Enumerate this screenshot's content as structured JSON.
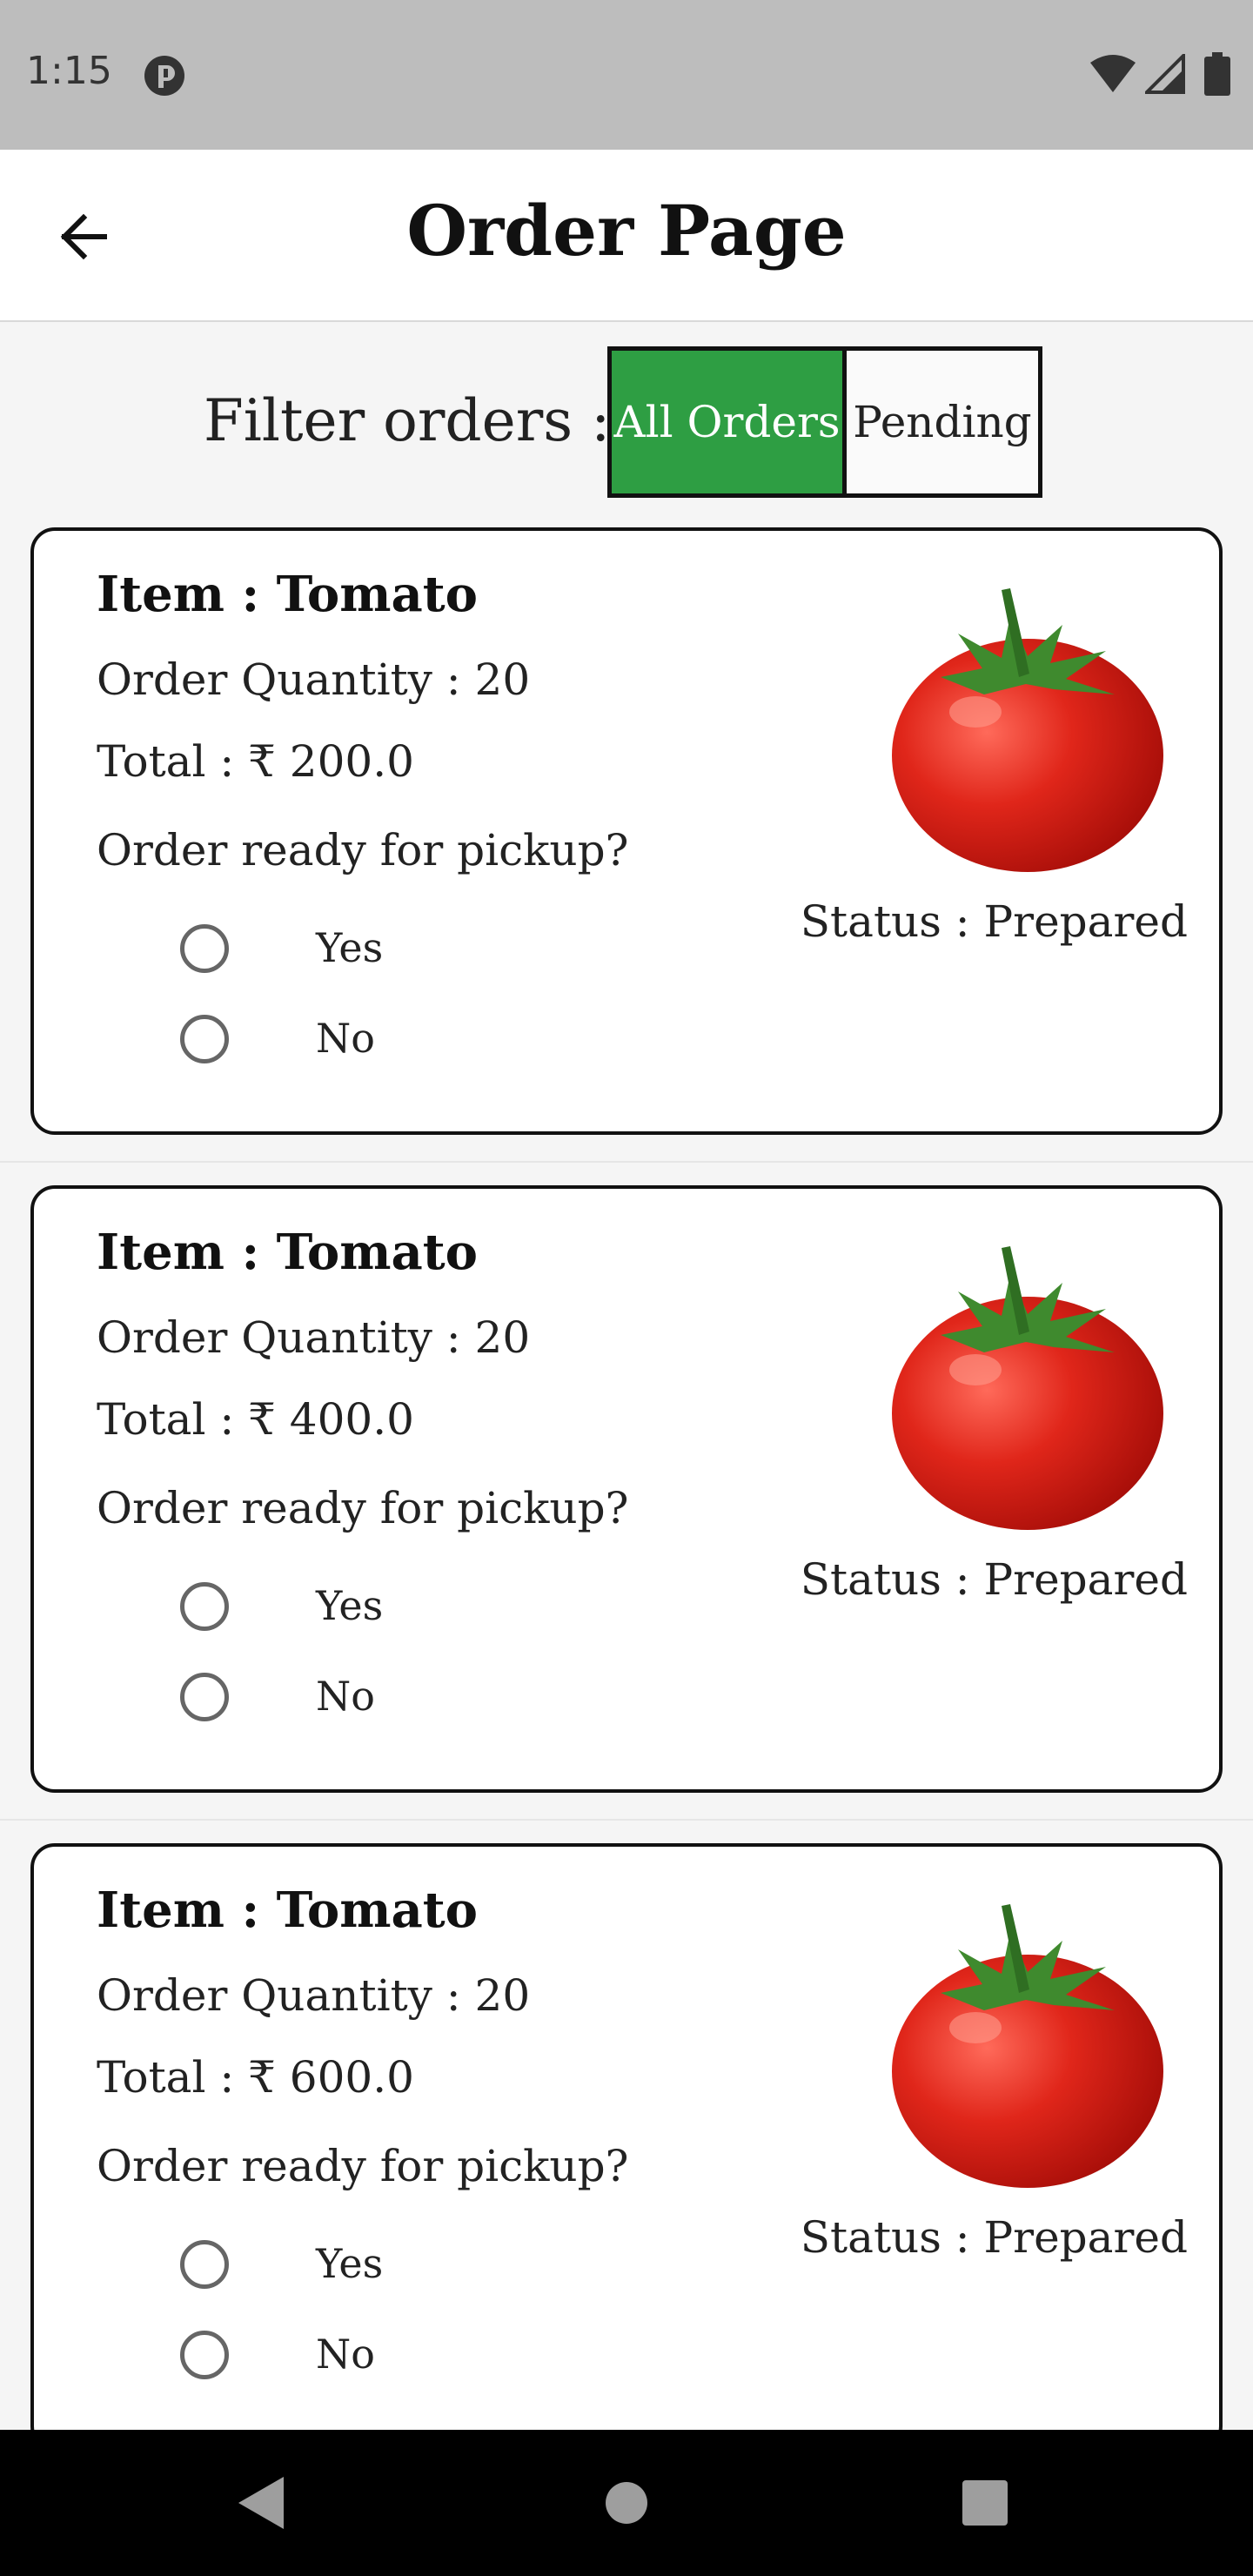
{
  "status_bar": {
    "time": "1:15",
    "icons": [
      "app-notification-icon",
      "wifi-icon",
      "cell-signal-icon",
      "battery-icon"
    ]
  },
  "app_bar": {
    "title": "Order Page",
    "back_icon": "arrow-back-icon"
  },
  "filter": {
    "label": "Filter orders :",
    "options": [
      "All Orders",
      "Pending"
    ],
    "selected": "All Orders",
    "selected_color": "#2e9e43"
  },
  "orders": [
    {
      "item": "Item : Tomato",
      "quantity": "Order Quantity : 20",
      "total": "Total : ₹ 200.0",
      "question": "Order ready for pickup?",
      "options": [
        "Yes",
        "No"
      ],
      "status": "Status : Prepared"
    },
    {
      "item": "Item : Tomato",
      "quantity": "Order Quantity : 20",
      "total": "Total : ₹ 400.0",
      "question": "Order ready for pickup?",
      "options": [
        "Yes",
        "No"
      ],
      "status": "Status : Prepared"
    },
    {
      "item": "Item : Tomato",
      "quantity": "Order Quantity : 20",
      "total": "Total : ₹ 600.0",
      "question": "Order ready for pickup?",
      "options": [
        "Yes",
        "No"
      ],
      "status": "Status : Prepared"
    }
  ],
  "nav_bar": {
    "icons": [
      "nav-back-icon",
      "nav-home-icon",
      "nav-recents-icon"
    ]
  }
}
